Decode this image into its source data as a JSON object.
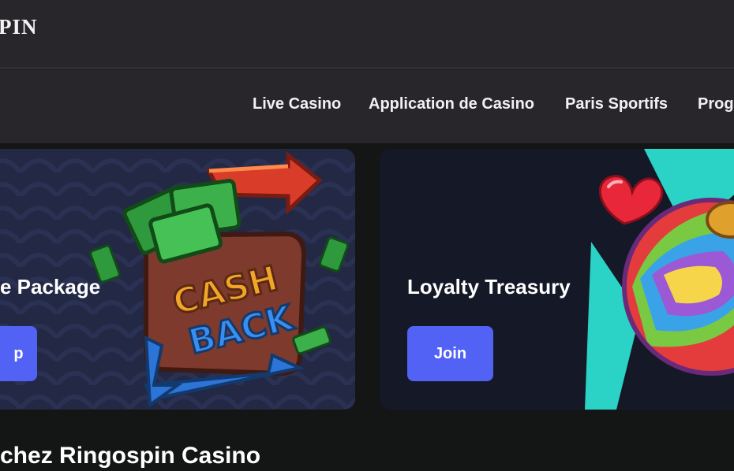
{
  "header": {
    "logo_text": "PIN"
  },
  "nav": {
    "items": [
      {
        "label": "Live Casino"
      },
      {
        "label": "Application de Casino"
      },
      {
        "label": "Paris Sportifs"
      },
      {
        "label": "Prog"
      }
    ]
  },
  "promos": [
    {
      "title": "e Package",
      "button_label": "p",
      "artwork": "cashback-wallet-illustration",
      "artwork_text": "CASH BACK"
    },
    {
      "title": "Loyalty Treasury",
      "button_label": "Join",
      "artwork": "candy-ball-illustration"
    }
  ],
  "section": {
    "title": "chez Ringospin Casino"
  },
  "colors": {
    "header_bg": "#28262b",
    "page_bg": "#131614",
    "button_accent": "#5162f5",
    "teal_accent": "#2ad3c5"
  }
}
